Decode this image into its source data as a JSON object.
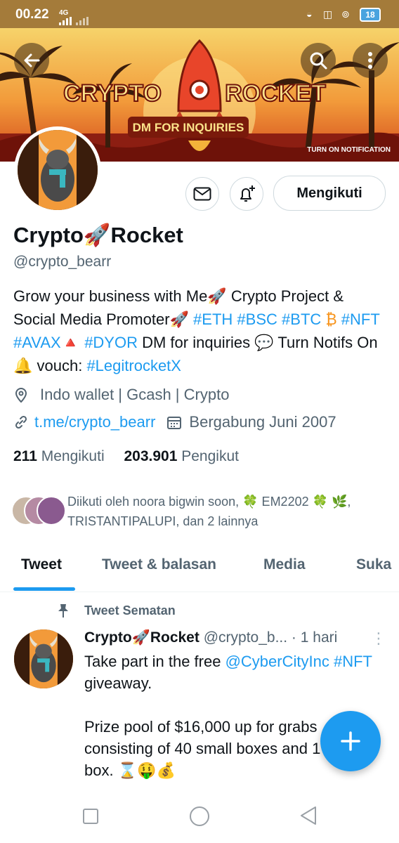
{
  "status_bar": {
    "time": "00.22",
    "network": "4G",
    "battery": "18"
  },
  "banner": {
    "title": "CRYPTO ROCKET",
    "subtitle": "DM FOR INQUIRIES",
    "notice": "TURN ON NOTIFICATION"
  },
  "header_actions": {
    "back_icon": "arrow-left-icon",
    "search_icon": "search-icon",
    "more_icon": "more-vertical-icon"
  },
  "profile": {
    "name_part1": "Crypto",
    "name_emoji": "🚀",
    "name_part2": "Rocket",
    "handle": "@crypto_bearr",
    "follow_button": "Mengikuti",
    "bio": {
      "t1": "Grow your business with Me🚀 Crypto Project & Social Media Promoter🚀 ",
      "h1": "#ETH",
      "s1": " ",
      "h2": "#BSC",
      "s2": " ",
      "h3": "#BTC",
      "t2": " ₿ ",
      "h4": "#NFT",
      "s3": " ",
      "h5": "#AVAX",
      "t3": "🔺 ",
      "h6": "#DYOR",
      "t4": " DM for inquiries 💬 Turn Notifs On 🔔 vouch: ",
      "h7": "#LegitrocketX"
    },
    "location": "Indo wallet | Gcash  | Crypto",
    "link": "t.me/crypto_bearr",
    "joined": "Bergabung Juni 2007",
    "following_count": "211",
    "following_label": "Mengikuti",
    "followers_count": "203.901",
    "followers_label": "Pengikut",
    "followed_by": "Diikuti oleh noora bigwin soon, 🍀 EM2202 🍀 🌿, TRISTANTIPALUPI, dan 2 lainnya"
  },
  "tabs": [
    {
      "label": "Tweet"
    },
    {
      "label": "Tweet & balasan"
    },
    {
      "label": "Media"
    },
    {
      "label": "Suka"
    }
  ],
  "pinned_tweet": {
    "pinned_label": "Tweet Sematan",
    "author_part1": "Crypto",
    "author_emoji": "🚀",
    "author_part2": "Rocket",
    "handle": "@crypto_b...",
    "time": "· 1 hari",
    "text_1": "Take part in the free ",
    "mention": "@CyberCityInc",
    "s1": " ",
    "hashtag": "#NFT",
    "text_2": " giveaway.",
    "text_3": "Prize pool of $16,000 up for grabs consisting of 40 small boxes and 1 giga box. ⌛🤑💰"
  },
  "colors": {
    "accent": "#1d9bf0",
    "text": "#0f1419",
    "secondary": "#536471",
    "status_bar": "#a47b3a"
  }
}
